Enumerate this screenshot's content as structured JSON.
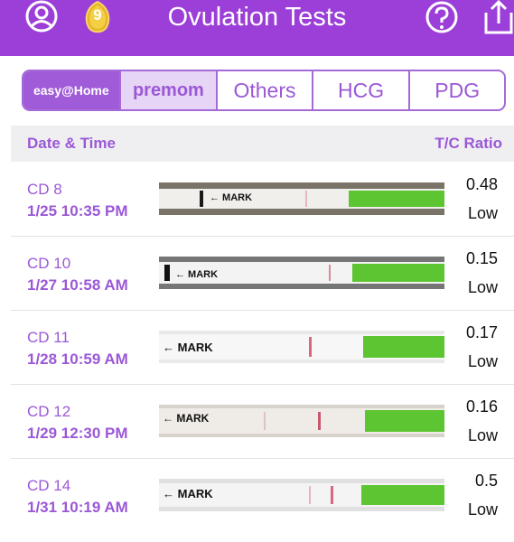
{
  "header": {
    "title": "Ovulation Tests",
    "badge_count": "9",
    "icons": [
      "profile-icon",
      "gold-coin-icon",
      "help-icon",
      "share-icon"
    ],
    "background": "#9b3fd8"
  },
  "brand_tabs": [
    {
      "label": "easy@Home",
      "selected": true
    },
    {
      "label": "premom",
      "selected": false
    },
    {
      "label": "Others",
      "selected": false
    },
    {
      "label": "HCG",
      "selected": false
    },
    {
      "label": "PDG",
      "selected": false
    }
  ],
  "table": {
    "col_date": "Date & Time",
    "col_ratio": "T/C Ratio",
    "strip_mark": "← MARK",
    "rows": [
      {
        "cd": "CD 8",
        "datetime": "1/25   10:35 PM",
        "ratio": "0.48",
        "level": "Low"
      },
      {
        "cd": "CD 10",
        "datetime": "1/27   10:58 AM",
        "ratio": "0.15",
        "level": "Low"
      },
      {
        "cd": "CD 11",
        "datetime": "1/28   10:59 AM",
        "ratio": "0.17",
        "level": "Low"
      },
      {
        "cd": "CD 12",
        "datetime": "1/29   12:30 PM",
        "ratio": "0.16",
        "level": "Low"
      },
      {
        "cd": "CD 14",
        "datetime": "1/31   10:19 AM",
        "ratio": "0.5",
        "level": "Low"
      }
    ]
  },
  "colors": {
    "accent": "#9b58d6",
    "strip_green": "#5cc531",
    "test_line": "#d9687d"
  }
}
